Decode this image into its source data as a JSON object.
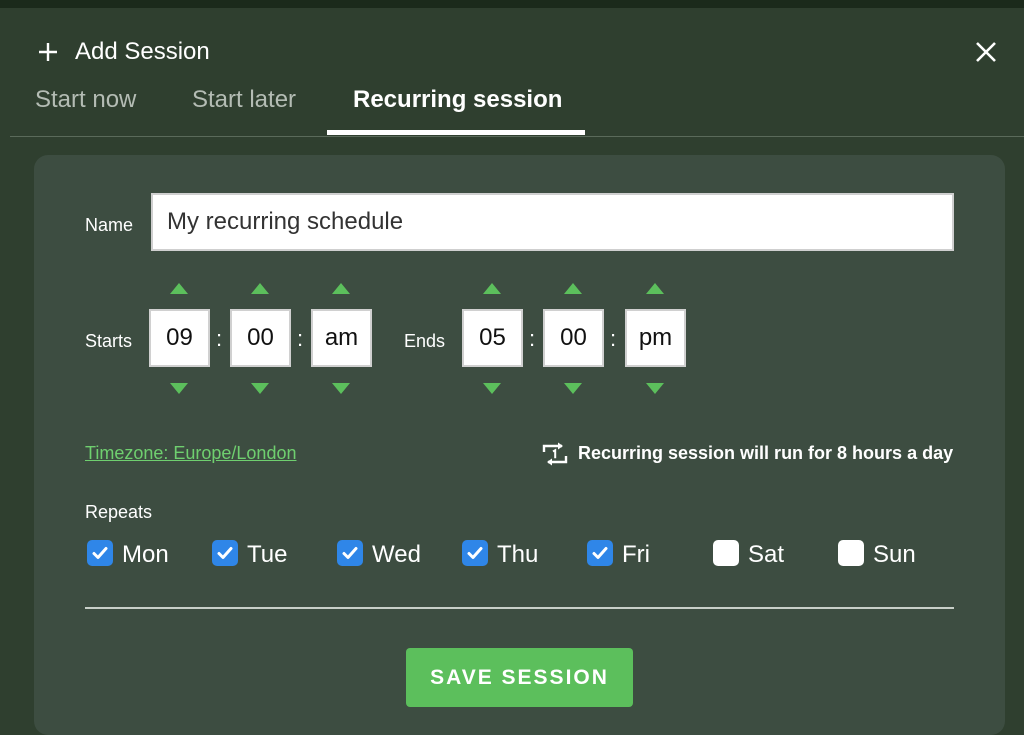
{
  "dialog": {
    "title": "Add Session",
    "add_icon": "plus-icon",
    "close_icon": "close-icon"
  },
  "tabs": [
    {
      "label": "Start now",
      "active": false
    },
    {
      "label": "Start later",
      "active": false
    },
    {
      "label": "Recurring session",
      "active": true
    }
  ],
  "form": {
    "name_label": "Name",
    "name_value": "My recurring schedule",
    "starts_label": "Starts",
    "ends_label": "Ends",
    "starts": {
      "hour": "09",
      "minute": "00",
      "period": "am"
    },
    "ends": {
      "hour": "05",
      "minute": "00",
      "period": "pm"
    },
    "separator": ":",
    "timezone_link": "Timezone: Europe/London",
    "duration_icon": "repeat-icon",
    "duration_text": "Recurring session will run for 8 hours a day",
    "repeats_label": "Repeats",
    "days": [
      {
        "label": "Mon",
        "checked": true
      },
      {
        "label": "Tue",
        "checked": true
      },
      {
        "label": "Wed",
        "checked": true
      },
      {
        "label": "Thu",
        "checked": true
      },
      {
        "label": "Fri",
        "checked": true
      },
      {
        "label": "Sat",
        "checked": false
      },
      {
        "label": "Sun",
        "checked": false
      }
    ],
    "save_label": "SAVE SESSION"
  },
  "colors": {
    "background": "#2f3f2f",
    "card": "#3d4d41",
    "accent_green": "#5cbf5c",
    "checkbox_blue": "#2f86e8"
  }
}
